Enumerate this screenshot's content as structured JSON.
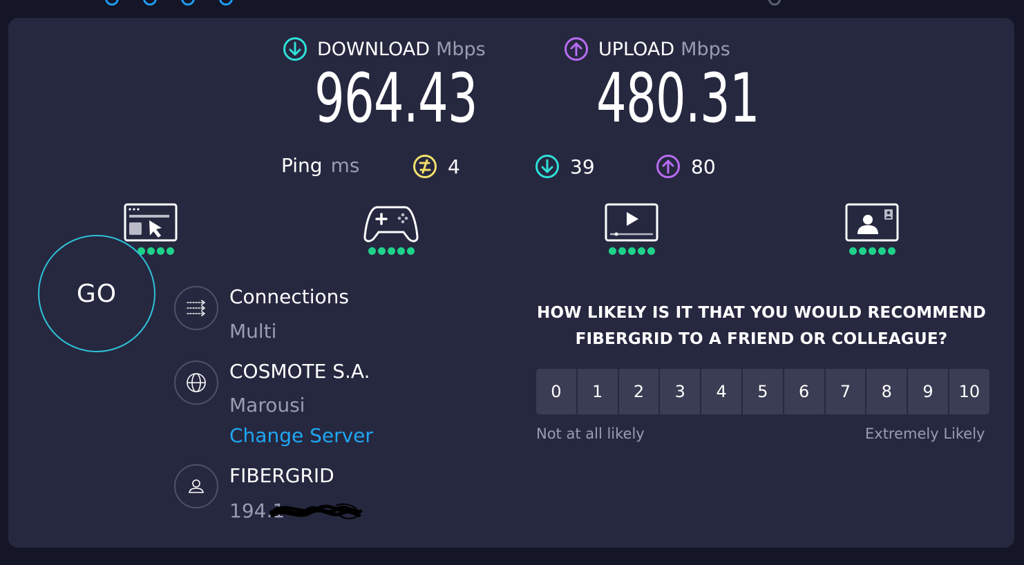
{
  "colors": {
    "page_bg": "#141526",
    "panel_bg": "#262840",
    "download_accent": "#2ee0d8",
    "upload_accent": "#b86cf2",
    "ping_accent": "#f3e16b",
    "link": "#1fa7f2",
    "good_dot": "#1fd28a",
    "go_ring": "#2ec3d8"
  },
  "download": {
    "label": "DOWNLOAD",
    "unit": "Mbps",
    "value": "964.43",
    "icon": "arrow-down-circle-icon"
  },
  "upload": {
    "label": "UPLOAD",
    "unit": "Mbps",
    "value": "480.31",
    "icon": "arrow-up-circle-icon"
  },
  "ping": {
    "label": "Ping",
    "unit": "ms",
    "idle": {
      "value": "4",
      "icon": "ping-idle-icon"
    },
    "download": {
      "value": "39",
      "icon": "arrow-down-circle-icon"
    },
    "upload": {
      "value": "80",
      "icon": "arrow-up-circle-icon"
    }
  },
  "use_cases": [
    {
      "icon": "web-browsing-icon",
      "rating_dots": 5
    },
    {
      "icon": "gaming-controller-icon",
      "rating_dots": 5
    },
    {
      "icon": "video-streaming-icon",
      "rating_dots": 5
    },
    {
      "icon": "video-call-icon",
      "rating_dots": 5
    }
  ],
  "go_button": {
    "label": "GO"
  },
  "connections": {
    "title": "Connections",
    "value": "Multi",
    "icon": "connections-icon"
  },
  "server": {
    "title": "COSMOTE S.A.",
    "location": "Marousi",
    "change_label": "Change Server",
    "icon": "globe-icon"
  },
  "provider": {
    "title": "FIBERGRID",
    "ip_visible": "194.1",
    "icon": "user-icon"
  },
  "survey": {
    "question_line1": "HOW LIKELY IS IT THAT YOU WOULD RECOMMEND",
    "question_line2": "FIBERGRID TO A FRIEND OR COLLEAGUE?",
    "scale": [
      "0",
      "1",
      "2",
      "3",
      "4",
      "5",
      "6",
      "7",
      "8",
      "9",
      "10"
    ],
    "low_label": "Not at all likely",
    "high_label": "Extremely Likely"
  }
}
